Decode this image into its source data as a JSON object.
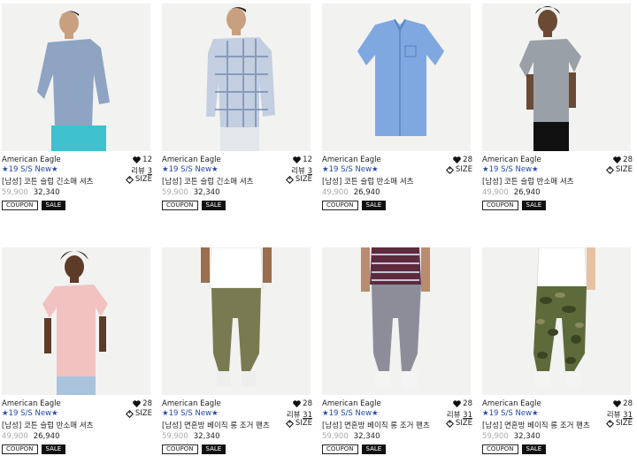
{
  "products": [
    {
      "brand": "American Eagle",
      "tagline": "★19 S/S New★",
      "name": "[남성] 코튼 슬럽 긴소매 셔츠",
      "old_price": "59,900",
      "price": "32,340",
      "likes": "12",
      "review_label": "리뷰",
      "review_count": "3",
      "size_label": "SIZE",
      "coupon_label": "COUPON",
      "sale_label": "SALE",
      "image_kind": "man-longsleeve-blue-shirt"
    },
    {
      "brand": "American Eagle",
      "tagline": "★19 S/S New★",
      "name": "[남성] 코튼 슬럽 긴소매 셔츠",
      "old_price": "59,900",
      "price": "32,340",
      "likes": "12",
      "review_label": "리뷰",
      "review_count": "3",
      "size_label": "SIZE",
      "coupon_label": "COUPON",
      "sale_label": "SALE",
      "image_kind": "man-plaid-shirt"
    },
    {
      "brand": "American Eagle",
      "tagline": "★19 S/S New★",
      "name": "[남성] 코튼 슬럽 반소매 셔츠",
      "old_price": "49,900",
      "price": "26,940",
      "likes": "28",
      "review_label": "",
      "review_count": "",
      "size_label": "SIZE",
      "coupon_label": "COUPON",
      "sale_label": "SALE",
      "image_kind": "flat-blue-shortsleeve-shirt"
    },
    {
      "brand": "American Eagle",
      "tagline": "★19 S/S New★",
      "name": "[남성] 코튼 슬럽 반소매 셔츠",
      "old_price": "49,900",
      "price": "26,940",
      "likes": "28",
      "review_label": "",
      "review_count": "",
      "size_label": "SIZE",
      "coupon_label": "COUPON",
      "sale_label": "SALE",
      "image_kind": "man-grey-shortsleeve-shirt"
    },
    {
      "brand": "American Eagle",
      "tagline": "★19 S/S New★",
      "name": "[남성] 코튼 슬럽 반소매 셔츠",
      "old_price": "49,900",
      "price": "26,940",
      "likes": "28",
      "review_label": "",
      "review_count": "",
      "size_label": "SIZE",
      "coupon_label": "COUPON",
      "sale_label": "SALE",
      "image_kind": "man-pink-shortsleeve-shirt"
    },
    {
      "brand": "American Eagle",
      "tagline": "★19 S/S New★",
      "name": "[남성] 면혼방 베이직 롱 조거 팬츠",
      "old_price": "59,900",
      "price": "32,340",
      "likes": "28",
      "review_label": "리뷰",
      "review_count": "31",
      "size_label": "SIZE",
      "coupon_label": "COUPON",
      "sale_label": "SALE",
      "image_kind": "olive-jogger-pants"
    },
    {
      "brand": "American Eagle",
      "tagline": "★19 S/S New★",
      "name": "[남성] 면혼방 베이직 롱 조거 팬츠",
      "old_price": "59,900",
      "price": "32,340",
      "likes": "28",
      "review_label": "리뷰",
      "review_count": "31",
      "size_label": "SIZE",
      "coupon_label": "COUPON",
      "sale_label": "SALE",
      "image_kind": "grey-jogger-pants"
    },
    {
      "brand": "American Eagle",
      "tagline": "★19 S/S New★",
      "name": "[남성] 면혼방 베이직 롱 조거 팬츠",
      "old_price": "59,900",
      "price": "32,340",
      "likes": "28",
      "review_label": "리뷰",
      "review_count": "31",
      "size_label": "SIZE",
      "coupon_label": "COUPON",
      "sale_label": "SALE",
      "image_kind": "camo-jogger-pants"
    }
  ]
}
